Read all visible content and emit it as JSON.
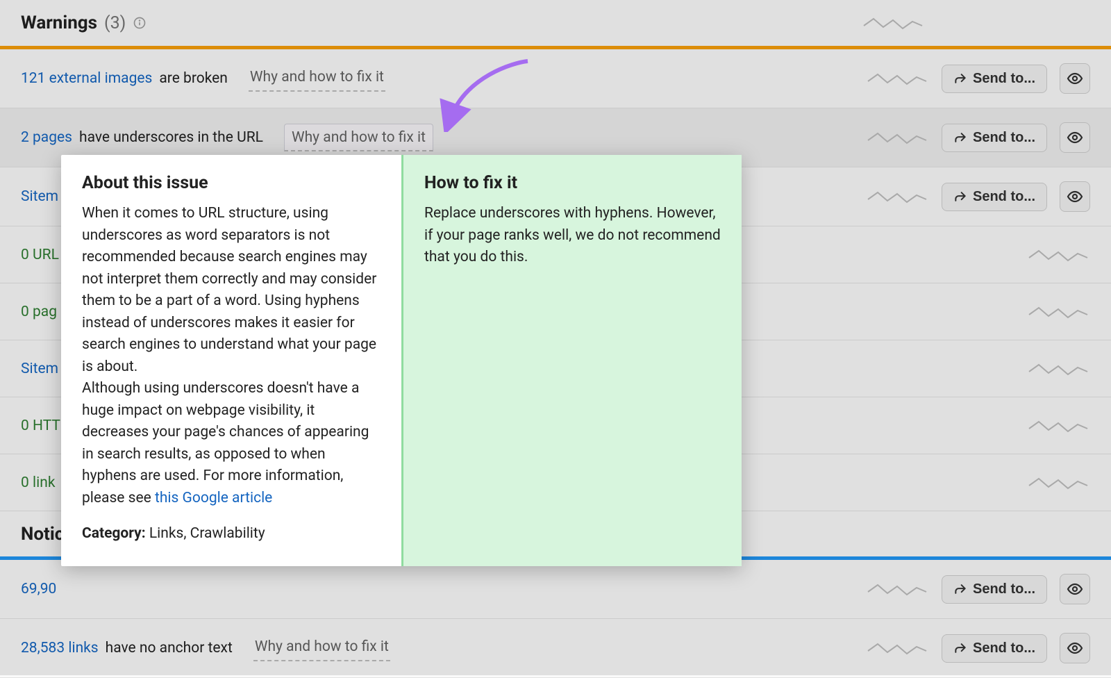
{
  "warnings": {
    "title": "Warnings",
    "count": "(3)"
  },
  "rows": [
    {
      "count_text": "121 external images",
      "desc_text": " are broken",
      "why": "Why and how to fix it",
      "count_class": "count-link",
      "send": true
    },
    {
      "count_text": "2 pages",
      "desc_text": " have underscores in the URL",
      "why": "Why and how to fix it",
      "count_class": "count-link",
      "send": true,
      "selected": true,
      "why_highlight": true
    },
    {
      "count_text": "Sitem",
      "desc_text": "",
      "why": "",
      "count_class": "count-link",
      "send": true
    },
    {
      "count_text": "0 URL",
      "desc_text": "",
      "why": "",
      "count_class": "count-zero",
      "send": false
    },
    {
      "count_text": "0 pag",
      "desc_text": "",
      "why": "",
      "count_class": "count-zero",
      "send": false
    },
    {
      "count_text": "Sitem",
      "desc_text": "",
      "why": "",
      "count_class": "count-link",
      "send": false
    },
    {
      "count_text": "0 HTT",
      "desc_text": "",
      "why": "",
      "count_class": "count-zero",
      "send": false
    },
    {
      "count_text": "0 link",
      "desc_text": "",
      "why": "",
      "count_class": "count-zero",
      "send": false
    }
  ],
  "notices": {
    "title": "Notic"
  },
  "notice_rows": [
    {
      "count_text": "69,90",
      "desc_text": "",
      "why": "",
      "count_class": "count-link",
      "send": true
    },
    {
      "count_text": "28,583 links",
      "desc_text": " have no anchor text",
      "why": "Why and how to fix it",
      "count_class": "count-link",
      "send": true
    }
  ],
  "send_label": "Send to...",
  "popover": {
    "about_title": "About this issue",
    "about_body_1": "When it comes to URL structure, using underscores as word separators is not recommended because search engines may not interpret them correctly and may consider them to be a part of a word. Using hyphens instead of underscores makes it easier for search engines to understand what your page is about.",
    "about_body_2a": "Although using underscores doesn't have a huge impact on webpage visibility, it decreases your page's chances of appearing in search results, as opposed to when hyphens are used. For more information, please see ",
    "about_link": "this Google article",
    "category_label": "Category:",
    "category_value": " Links, Crawlability",
    "fix_title": "How to fix it",
    "fix_body": "Replace underscores with hyphens. However, if your page ranks well, we do not recommend that you do this."
  }
}
